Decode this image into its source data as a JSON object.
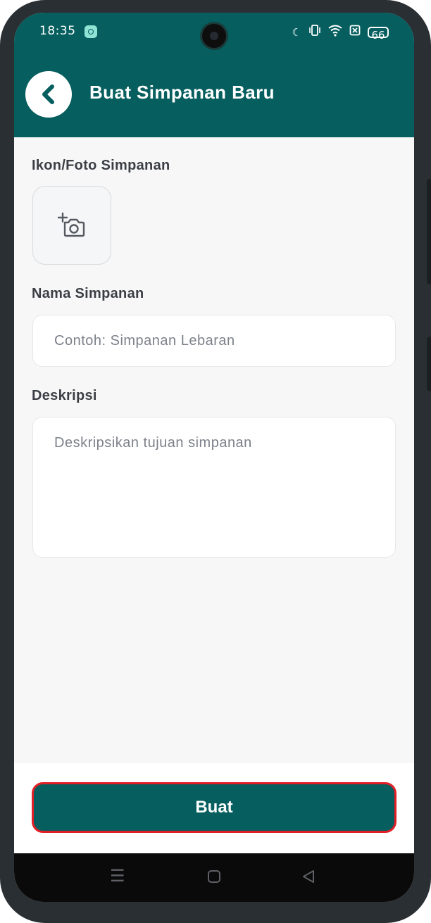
{
  "status_bar": {
    "time": "18:35",
    "icons": [
      "chat-notification-icon",
      "moon-icon",
      "vibrate-icon",
      "wifi-icon",
      "sim-off-icon",
      "battery-icon"
    ],
    "battery_level": "66"
  },
  "header": {
    "title": "Buat Simpanan Baru",
    "back_icon": "chevron-left-icon",
    "color": "#065e5f"
  },
  "form": {
    "photo_label": "Ikon/Foto Simpanan",
    "photo_icon": "add-camera-icon",
    "name_label": "Nama Simpanan",
    "name_placeholder": "Contoh: Simpanan Lebaran",
    "name_value": "",
    "description_label": "Deskripsi",
    "description_placeholder": "Deskripsikan tujuan simpanan",
    "description_value": ""
  },
  "submit_button": {
    "label": "Buat",
    "color": "#065e5f",
    "highlight_color": "#e21e26"
  },
  "nav_bar": {
    "items": [
      "menu-icon",
      "home-square-icon",
      "back-triangle-icon"
    ]
  }
}
